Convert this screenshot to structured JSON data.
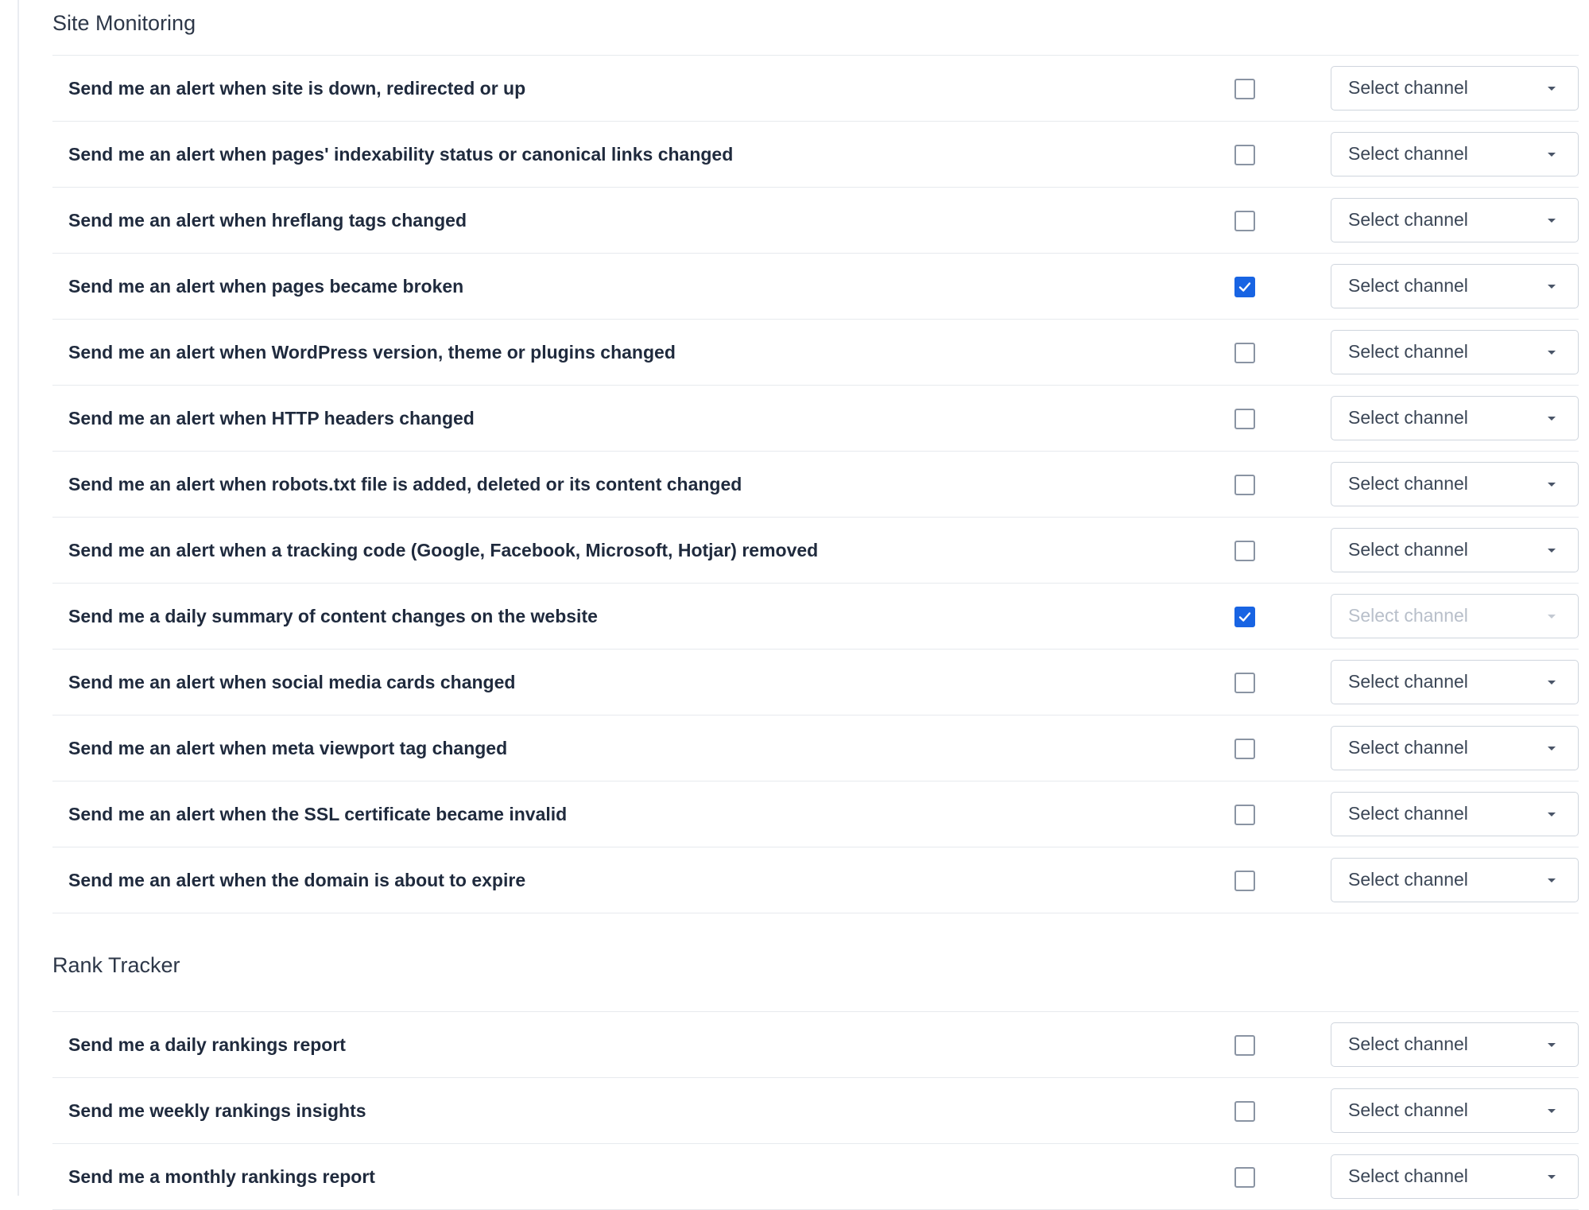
{
  "sections": [
    {
      "title": "Site Monitoring",
      "rows": [
        {
          "label": "Send me an alert when site is down, redirected or up",
          "checked": false,
          "channel": "Select channel",
          "disabled": false
        },
        {
          "label": "Send me an alert when pages' indexability status or canonical links changed",
          "checked": false,
          "channel": "Select channel",
          "disabled": false
        },
        {
          "label": "Send me an alert when hreflang tags changed",
          "checked": false,
          "channel": "Select channel",
          "disabled": false
        },
        {
          "label": "Send me an alert when pages became broken",
          "checked": true,
          "channel": "Select channel",
          "disabled": false
        },
        {
          "label": "Send me an alert when WordPress version, theme or plugins changed",
          "checked": false,
          "channel": "Select channel",
          "disabled": false
        },
        {
          "label": "Send me an alert when HTTP headers changed",
          "checked": false,
          "channel": "Select channel",
          "disabled": false
        },
        {
          "label": "Send me an alert when robots.txt file is added, deleted or its content changed",
          "checked": false,
          "channel": "Select channel",
          "disabled": false
        },
        {
          "label": "Send me an alert when a tracking code (Google, Facebook, Microsoft, Hotjar) removed",
          "checked": false,
          "channel": "Select channel",
          "disabled": false
        },
        {
          "label": "Send me a daily summary of content changes on the website",
          "checked": true,
          "channel": "Select channel",
          "disabled": true
        },
        {
          "label": "Send me an alert when social media cards changed",
          "checked": false,
          "channel": "Select channel",
          "disabled": false
        },
        {
          "label": "Send me an alert when meta viewport tag changed",
          "checked": false,
          "channel": "Select channel",
          "disabled": false
        },
        {
          "label": "Send me an alert when the SSL certificate became invalid",
          "checked": false,
          "channel": "Select channel",
          "disabled": false
        },
        {
          "label": "Send me an alert when the domain is about to expire",
          "checked": false,
          "channel": "Select channel",
          "disabled": false
        }
      ]
    },
    {
      "title": "Rank Tracker",
      "rows": [
        {
          "label": "Send me a daily rankings report",
          "checked": false,
          "channel": "Select channel",
          "disabled": false
        },
        {
          "label": "Send me weekly rankings insights",
          "checked": false,
          "channel": "Select channel",
          "disabled": false
        },
        {
          "label": "Send me a monthly rankings report",
          "checked": false,
          "channel": "Select channel",
          "disabled": false
        }
      ]
    }
  ],
  "colors": {
    "accent": "#1864e3",
    "text": "#1f2a3d",
    "border": "#e7eaee"
  }
}
